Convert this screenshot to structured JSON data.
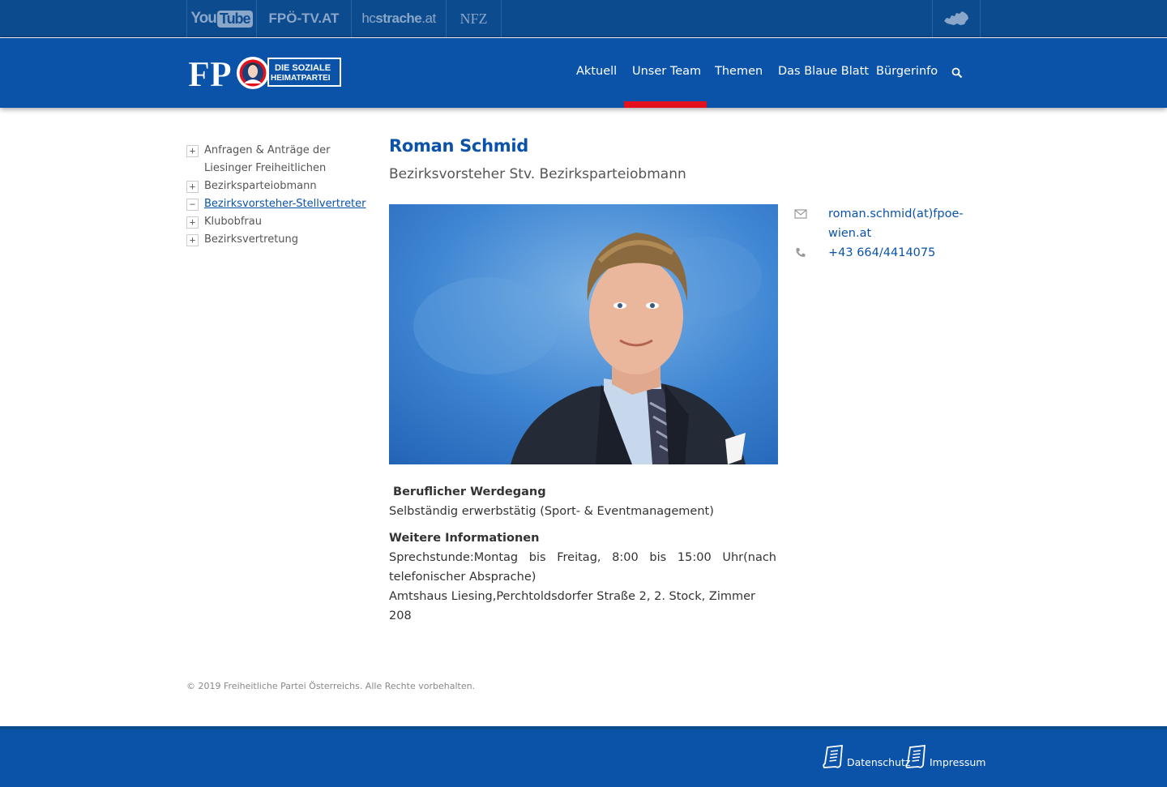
{
  "topbar": {
    "links": [
      {
        "label": "YouTube"
      },
      {
        "label": "FPÖ-TV.AT"
      },
      {
        "label": "hcstrache.at"
      },
      {
        "label": "NFZ"
      }
    ]
  },
  "header": {
    "logo_text": "FPÖ",
    "logo_tagline_1": "DIE SOZIALE",
    "logo_tagline_2": "HEIMATPARTEI",
    "nav": [
      "Aktuell",
      "Unser Team",
      "Themen",
      "Das Blaue Blatt",
      "Bürgerinfo"
    ],
    "active_nav": "Unser Team",
    "accent_color": "#e3101e",
    "brand_color": "#0a53a8"
  },
  "sidebar": {
    "items": [
      {
        "label": "Anfragen & Anträge der Liesinger Freiheitlichen",
        "expander": "+"
      },
      {
        "label": "Bezirksparteiobmann",
        "expander": "+"
      },
      {
        "label": "Bezirksvorsteher-Stellvertreter",
        "expander": "−",
        "active": true
      },
      {
        "label": "Klubobfrau",
        "expander": "+"
      },
      {
        "label": "Bezirksvertretung",
        "expander": "+"
      }
    ]
  },
  "profile": {
    "name": "Roman Schmid",
    "subtitle": "Bezirksvorsteher Stv. Bezirksparteiobmann",
    "email_line1": "roman.schmid(at)fpoe-",
    "email_line2": "wien.at",
    "phone": "+43 664/4414075",
    "career_heading": " Beruflicher Werdegang",
    "career_text": "Selbständig erwerbstätig (Sport- & Eventmanagement)",
    "info_heading": "Weitere Informationen",
    "office_hours": "Sprechstunde:Montag bis Freitag, 8:00 bis 15:00 Uhr(nach telefonischer Absprache)",
    "address": "Amtshaus Liesing,Perchtoldsdorfer Straße 2, 2. Stock, Zimmer 208"
  },
  "copyright": "© 2019 Freiheitliche Partei Österreichs. Alle Rechte vorbehalten.",
  "footer": {
    "links": [
      "Datenschutz",
      "Impressum"
    ]
  }
}
